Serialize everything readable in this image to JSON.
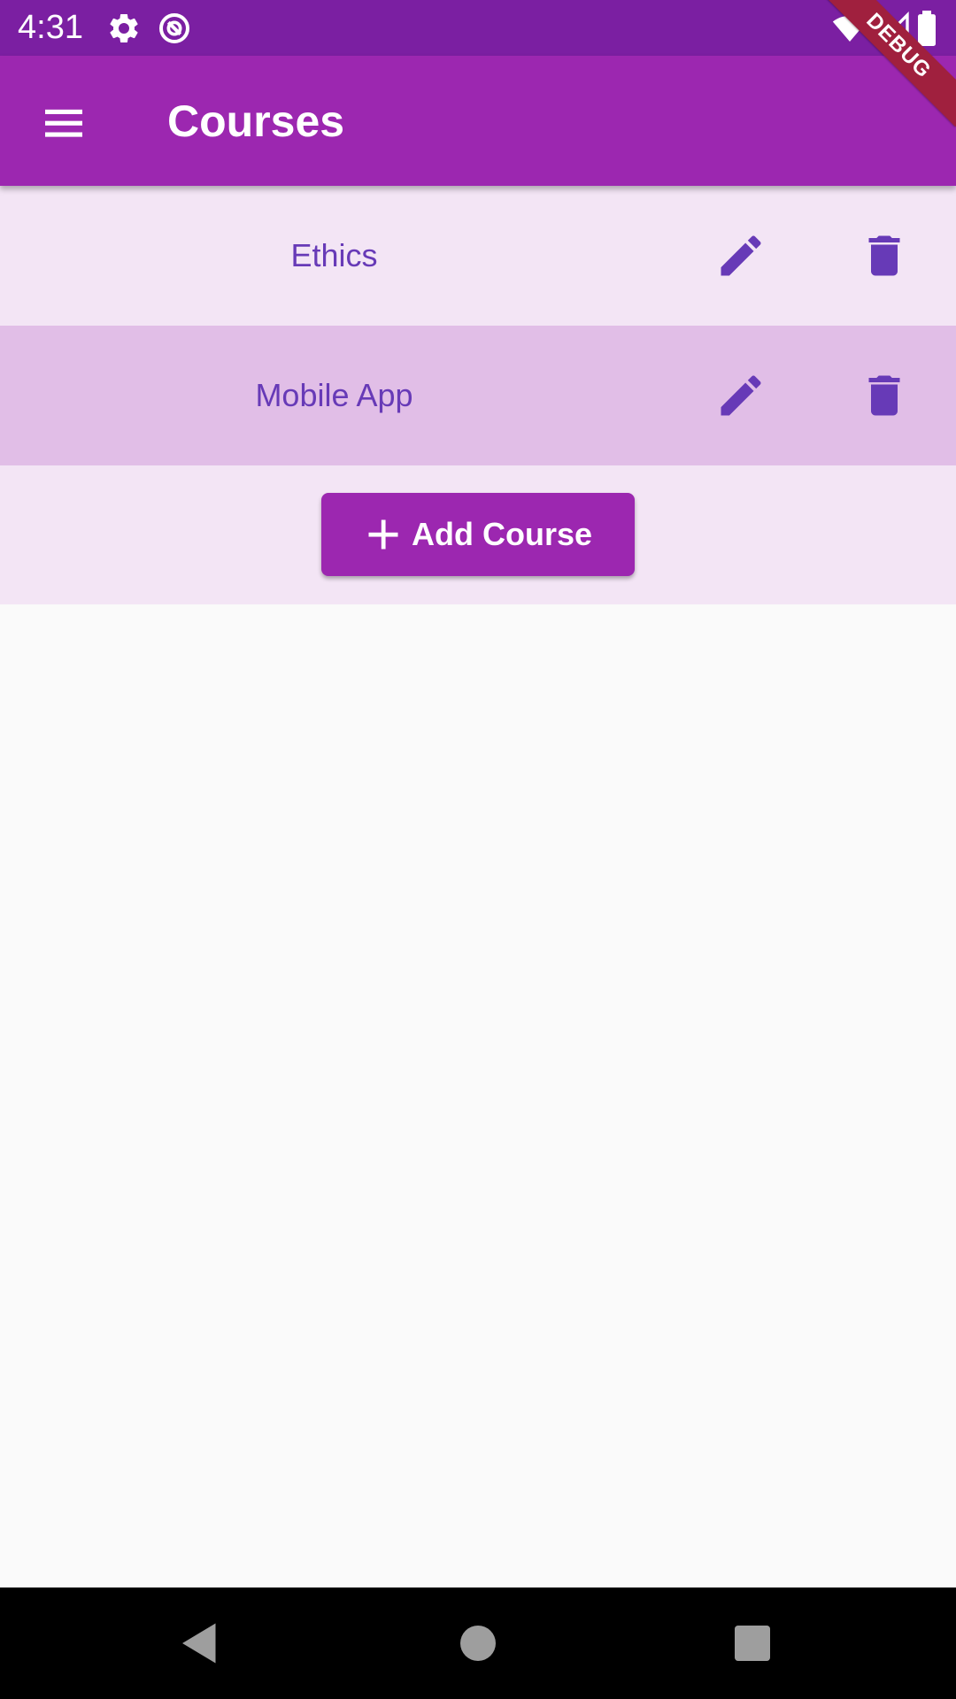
{
  "status_bar": {
    "time": "4:31",
    "icons": [
      "settings-icon",
      "sync-icon",
      "wifi-icon",
      "signal-icon",
      "battery-icon"
    ]
  },
  "app_bar": {
    "title": "Courses",
    "menu_icon": "menu-icon"
  },
  "debug_banner": "DEBUG",
  "courses": [
    {
      "name": "Ethics",
      "edit_icon": "edit-icon",
      "delete_icon": "delete-icon"
    },
    {
      "name": "Mobile App",
      "edit_icon": "edit-icon",
      "delete_icon": "delete-icon"
    }
  ],
  "add_button": {
    "label": "Add Course",
    "icon": "plus-icon"
  },
  "nav_bar": {
    "buttons": [
      "back-icon",
      "home-icon",
      "recents-icon"
    ]
  },
  "colors": {
    "status_bar": "#7b1fa2",
    "app_bar": "#9c27b0",
    "row_light": "#f3e5f5",
    "row_dark": "#e1bee7",
    "accent_text": "#673ab7",
    "debug": "#a0203e"
  }
}
